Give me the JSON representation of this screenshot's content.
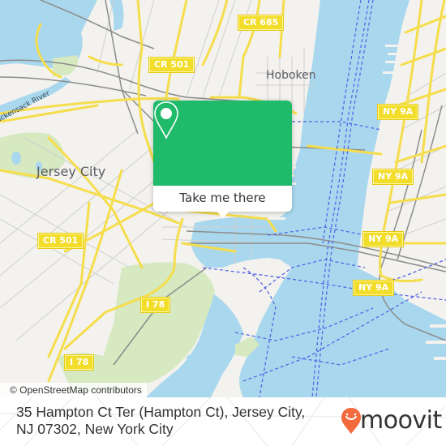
{
  "map": {
    "colors": {
      "land": "#f3f2ee",
      "water": "#a9d8ee",
      "park": "#d6e9c0",
      "road_major": "#f5dd4c",
      "road_minor": "#c9c9c9",
      "rail": "#888888",
      "ferry": "#5566e6"
    },
    "place_labels": [
      {
        "name": "Hoboken"
      },
      {
        "name": "Jersey City"
      }
    ],
    "water_labels": [
      {
        "name": "Hackensack River"
      }
    ],
    "road_shields": [
      {
        "label": "CR 685"
      },
      {
        "label": "CR 501"
      },
      {
        "label": "CR 501"
      },
      {
        "label": "NY 9A"
      },
      {
        "label": "NY 9A"
      },
      {
        "label": "NY 9A"
      },
      {
        "label": "NY 9A"
      },
      {
        "label": "I 78"
      },
      {
        "label": "I 78"
      }
    ],
    "attribution": "© OpenStreetMap contributors"
  },
  "popup": {
    "icon": "map-pin-icon",
    "cta_label": "Take me there",
    "accent_color": "#1fba6a"
  },
  "footer": {
    "address": "35 Hampton Ct Ter (Hampton Ct), Jersey City, NJ 07302, New York City",
    "brand": "moovit",
    "brand_color": "#f26a3d"
  }
}
